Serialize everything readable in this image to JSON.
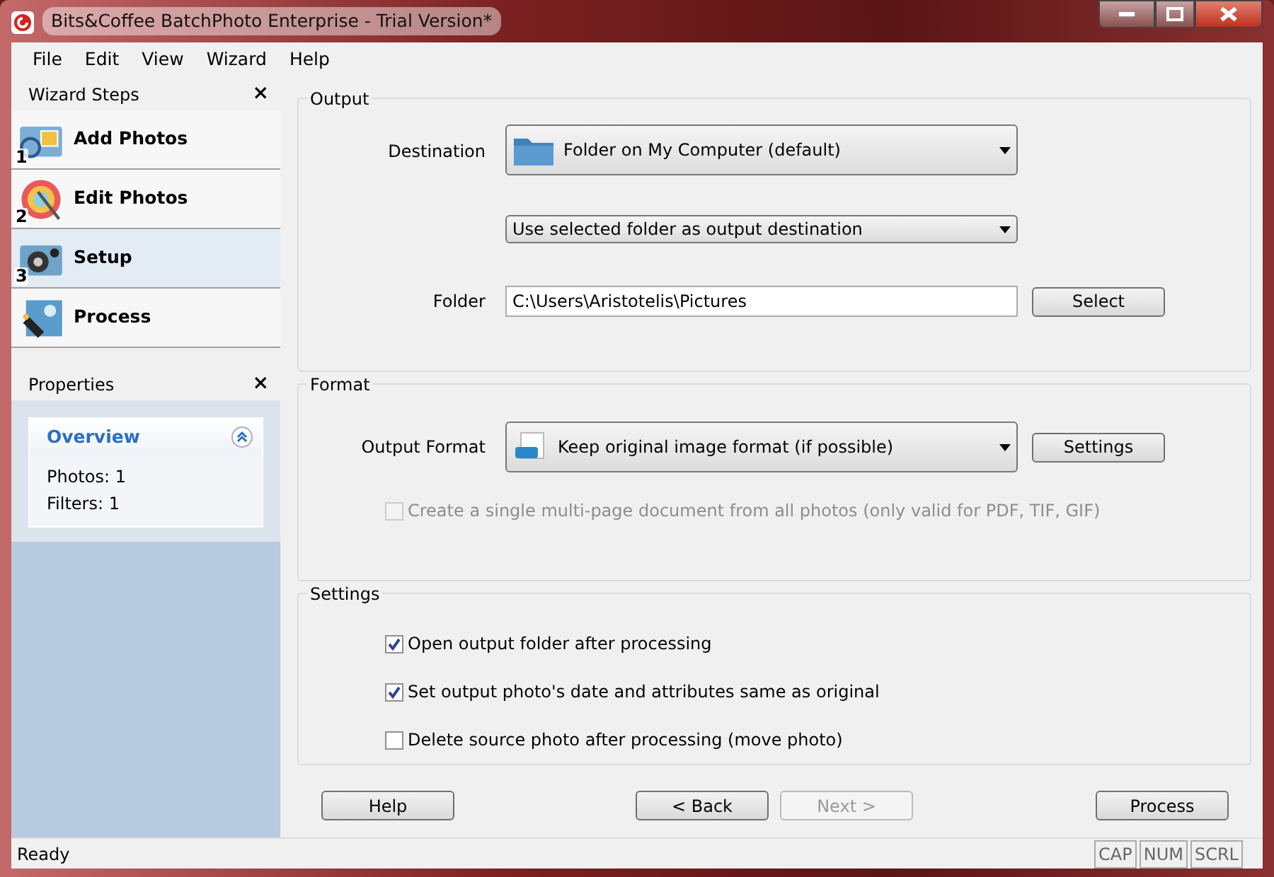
{
  "window": {
    "title": "Bits&Coffee BatchPhoto Enterprise - Trial Version*"
  },
  "menu": [
    "File",
    "Edit",
    "View",
    "Wizard",
    "Help"
  ],
  "wizard_steps": {
    "title": "Wizard Steps",
    "close": "×",
    "items": [
      {
        "label": "Add Photos",
        "number": "1",
        "selected": false
      },
      {
        "label": "Edit Photos",
        "number": "2",
        "selected": false
      },
      {
        "label": "Setup",
        "number": "3",
        "selected": true
      },
      {
        "label": "Process",
        "selected": false
      }
    ]
  },
  "properties": {
    "title": "Properties",
    "close": "×",
    "overview": {
      "title": "Overview",
      "expanded": true,
      "lines": [
        "Photos: 1",
        "Filters: 1"
      ]
    }
  },
  "output": {
    "title": "Output",
    "destination_label": "Destination",
    "destination": "Folder on My Computer (default)",
    "mode": "Use selected folder as output destination",
    "folder_label": "Folder",
    "folder": "C:\\Users\\Aristotelis\\Pictures",
    "select_button": "Select"
  },
  "format": {
    "title": "Format",
    "label": "Output Format",
    "value": "Keep original image format (if possible)",
    "settings_button": "Settings",
    "multipage": {
      "label": "Create a single multi-page document from all photos (only valid for PDF, TIF, GIF)",
      "checked": false,
      "disabled": true
    }
  },
  "settings": {
    "title": "Settings",
    "options": [
      {
        "label": "Open output folder after processing",
        "checked": true,
        "disabled": false
      },
      {
        "label": "Set output photo's date and attributes same as original",
        "checked": true,
        "disabled": false
      },
      {
        "label": "Delete source photo after processing (move photo)",
        "checked": false,
        "disabled": false
      }
    ]
  },
  "buttons": [
    {
      "label": "Help",
      "disabled": false
    },
    {
      "label": "< Back",
      "disabled": false
    },
    {
      "label": "Next >",
      "disabled": true
    },
    {
      "label": "Process",
      "disabled": false
    }
  ],
  "status_bar": {
    "text": "Ready",
    "indicators": [
      "CAP",
      "NUM",
      "SCRL"
    ]
  }
}
